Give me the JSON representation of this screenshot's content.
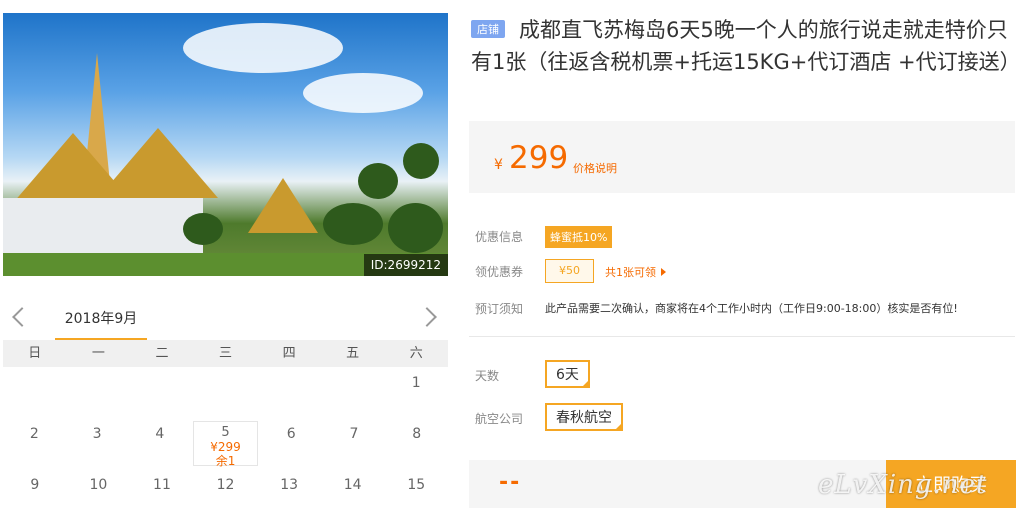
{
  "product": {
    "photo_id": "ID:2699212",
    "tag": "店铺",
    "title": "成都直飞苏梅岛6天5晚一个人的旅行说走就走特价只有1张（往返含税机票+托运15KG+代订酒店 +代订接送）"
  },
  "calendar": {
    "month": "2018年9月",
    "weekdays": [
      "日",
      "一",
      "二",
      "三",
      "四",
      "五",
      "六"
    ],
    "rows": [
      [
        "",
        "",
        "",
        "",
        "",
        "",
        "1"
      ],
      [
        "2",
        "3",
        "4",
        "5",
        "6",
        "7",
        "8"
      ],
      [
        "9",
        "10",
        "11",
        "12",
        "13",
        "14",
        "15"
      ]
    ],
    "selected": {
      "day": "5",
      "price": "¥299",
      "stock": "余1"
    }
  },
  "price": {
    "symbol": "¥",
    "value": "299",
    "note": "价格说明"
  },
  "info": {
    "promo_label": "优惠信息",
    "promo_value": "蜂蜜抵10%",
    "coupon_label": "领优惠券",
    "coupon_value": "¥50",
    "coupon_link": "共1张可领",
    "notice_label": "预订须知",
    "notice_text": "此产品需要二次确认，商家将在4个工作小时内（工作日9:00-18:00）核实是否有位!"
  },
  "options": {
    "days_label": "天数",
    "days_value": "6天",
    "airline_label": "航空公司",
    "airline_value": "春秋航空"
  },
  "buy": {
    "total": "--",
    "button": "立即购买"
  },
  "watermark": "eLvXing.net",
  "colors": {
    "accent": "#f5a623",
    "price": "#f56a00",
    "tag": "#7ea6f0"
  }
}
